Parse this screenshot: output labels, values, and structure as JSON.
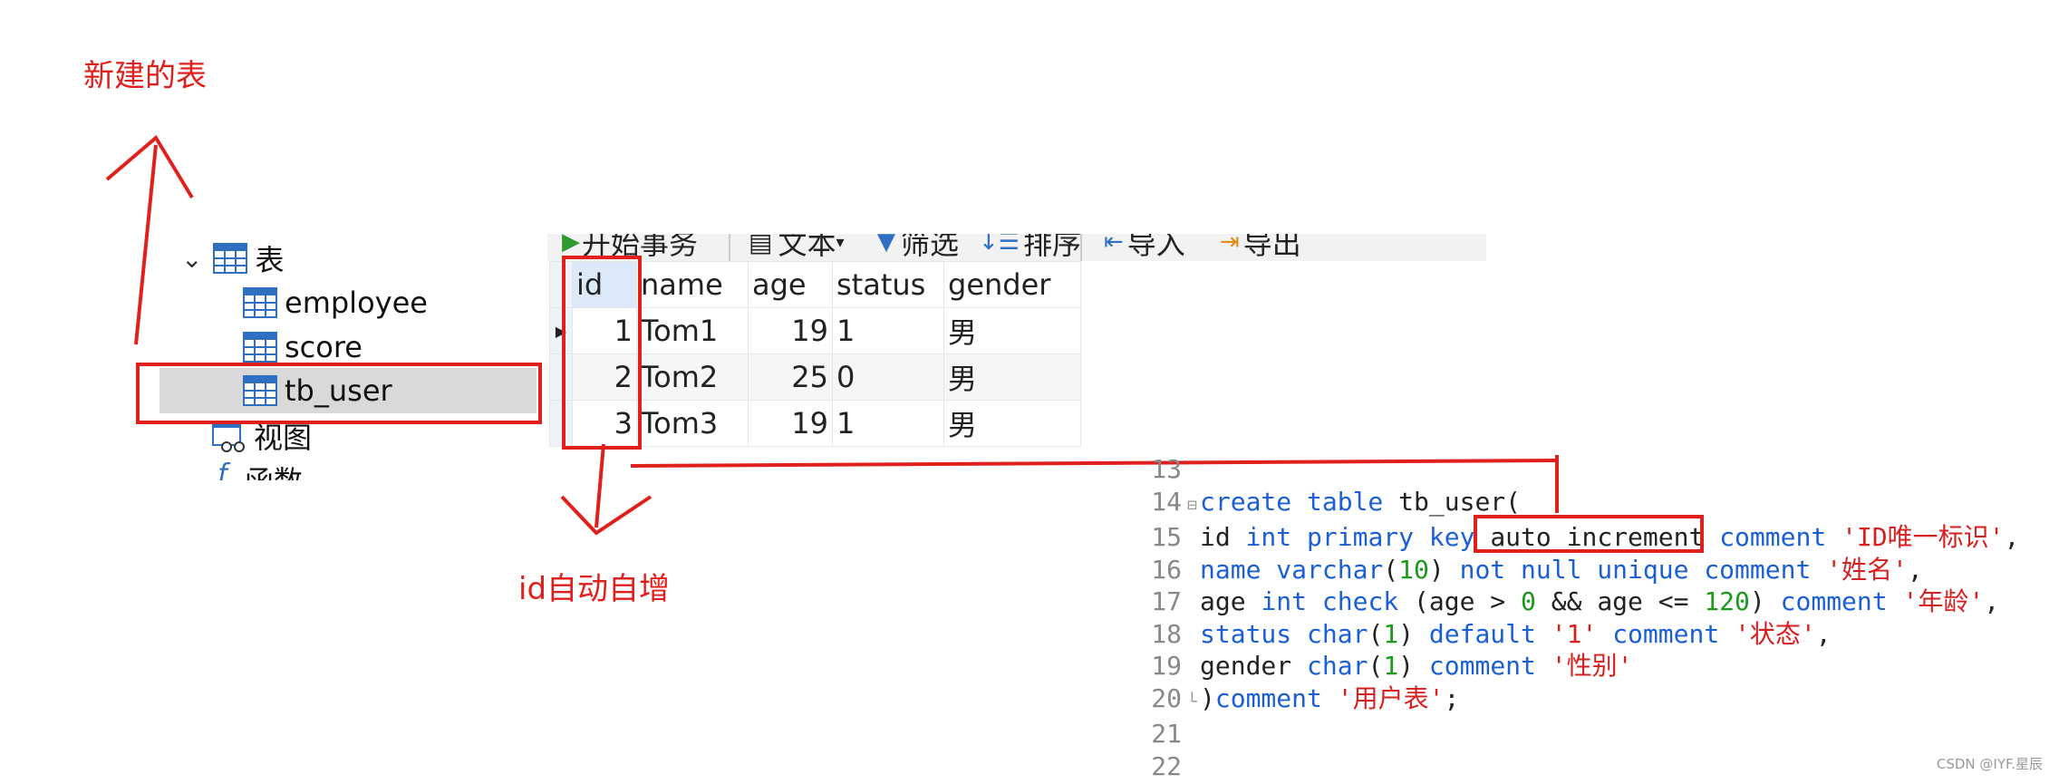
{
  "annotations": {
    "new_table_label": "新建的表",
    "auto_increment_label": "id自动自增"
  },
  "tree": {
    "group_label": "表",
    "tables": [
      "employee",
      "score",
      "tb_user"
    ],
    "views_label": "视图",
    "functions_label": "函数"
  },
  "toolbar": {
    "begin_transaction": "开始事务",
    "text": "文本",
    "filter": "筛选",
    "sort": "排序",
    "import": "导入",
    "export": "导出"
  },
  "grid": {
    "columns": [
      "id",
      "name",
      "age",
      "status",
      "gender"
    ],
    "rows": [
      [
        "1",
        "Tom1",
        "19",
        "1",
        "男"
      ],
      [
        "2",
        "Tom2",
        "25",
        "0",
        "男"
      ],
      [
        "3",
        "Tom3",
        "19",
        "1",
        "男"
      ]
    ]
  },
  "code": {
    "line_numbers": [
      "13",
      "14",
      "15",
      "16",
      "17",
      "18",
      "19",
      "20",
      "21",
      "22"
    ]
  },
  "watermark": "CSDN @IYF.星辰",
  "colors": {
    "annotation_red": "#e0201c",
    "keyword_blue": "#1a5fd6",
    "string_red": "#d62020",
    "number_green": "#1a9a1a"
  }
}
